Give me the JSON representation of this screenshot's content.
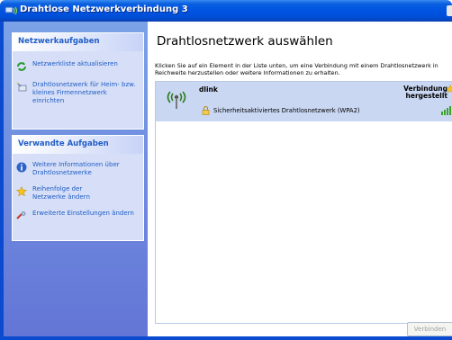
{
  "window": {
    "title": "Drahtlose Netzwerkverbindung 3"
  },
  "sidebar": {
    "network_tasks": {
      "header": "Netzwerkaufgaben",
      "items": [
        {
          "label": "Netzwerkliste aktualisieren",
          "icon": "refresh-icon"
        },
        {
          "label": "Drahtlosnetzwerk für Heim- bzw. kleines Firmennetzwerk einrichten",
          "icon": "wizard-icon"
        }
      ]
    },
    "related_tasks": {
      "header": "Verwandte Aufgaben",
      "items": [
        {
          "label": "Weitere Informationen über Drahtlosnetzwerke",
          "icon": "info-icon"
        },
        {
          "label": "Reihenfolge der Netzwerke ändern",
          "icon": "star-icon"
        },
        {
          "label": "Erweiterte Einstellungen ändern",
          "icon": "settings-icon"
        }
      ]
    }
  },
  "main": {
    "heading": "Drahtlosnetzwerk auswählen",
    "description": "Klicken Sie auf ein Element in der Liste unten, um eine Verbindung mit einem Drahtlosnetzwerk in Reichweite herzustellen oder weitere Informationen zu erhalten.",
    "networks": [
      {
        "ssid": "dlink",
        "status_line1": "Verbindung",
        "status_line2": "hergestellt",
        "security": "Sicherheitsaktiviertes Drahtlosnetzwerk (WPA2)"
      }
    ],
    "connect_label": "Verbinden"
  },
  "colors": {
    "titlebar": "#0054e3",
    "sidebar_bg": "#6f8de0",
    "panel_bg": "#d6dff7",
    "link": "#215dc6",
    "selected_row": "#c9d7f2"
  }
}
